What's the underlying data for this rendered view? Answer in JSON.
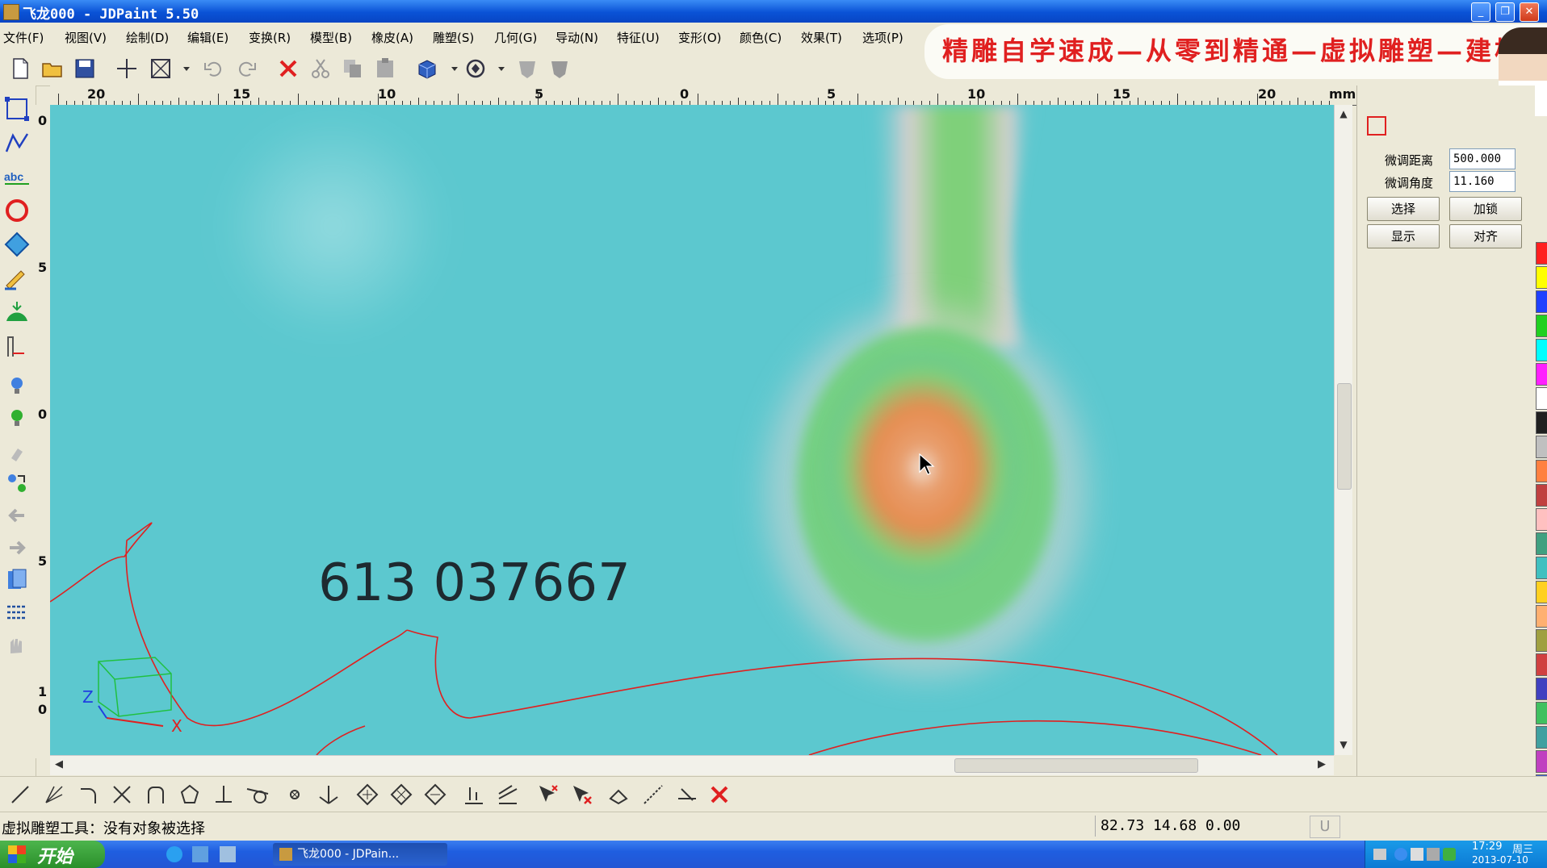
{
  "window": {
    "title": "飞龙000 - JDPaint 5.50"
  },
  "menu": {
    "items": [
      "文件(F)",
      "视图(V)",
      "绘制(D)",
      "编辑(E)",
      "变换(R)",
      "模型(B)",
      "橡皮(A)",
      "雕塑(S)",
      "几何(G)",
      "导动(N)",
      "特征(U)",
      "变形(O)",
      "颜色(C)",
      "效果(T)",
      "选项(P)"
    ]
  },
  "promo": {
    "text": "精雕自学速成—从零到精通—虚拟雕塑—建模"
  },
  "ruler": {
    "unit": "mm",
    "top_labels": [
      "20",
      "15",
      "10",
      "5",
      "0",
      "5",
      "10",
      "15",
      "20"
    ],
    "left_labels": [
      "0",
      "5",
      "0",
      "5",
      "1",
      "0"
    ]
  },
  "canvas": {
    "overlay_number": "613 037667",
    "axis_labels": {
      "z": "Z",
      "x": "X"
    }
  },
  "panel": {
    "fine_distance_label": "微调距离",
    "fine_distance_value": "500.000",
    "fine_angle_label": "微调角度",
    "fine_angle_value": "11.160",
    "buttons": [
      "选择",
      "加锁",
      "显示",
      "对齐"
    ]
  },
  "palette": {
    "colors": [
      "#ff2020",
      "#ffff00",
      "#2040ff",
      "#20d020",
      "#00ffff",
      "#ff20ff",
      "#ffffff",
      "#202020",
      "#c0c0c0",
      "#ff8040",
      "#c04040",
      "#ffc0c0",
      "#40a080",
      "#40c0c0",
      "#ffd020",
      "#ffb070",
      "#a0a040",
      "#d04040",
      "#4040c0",
      "#40c060",
      "#40a0a0",
      "#c040c0",
      "#4060d0"
    ]
  },
  "status": {
    "message": "虚拟雕塑工具：没有对象被选择",
    "coords": "82.73 14.68 0.00",
    "mode": "U"
  },
  "taskbar": {
    "start_label": "开始",
    "task_label": "飞龙000 - JDPain...",
    "time": "17:29",
    "weekday": "周三",
    "date": "2013-07-10"
  }
}
